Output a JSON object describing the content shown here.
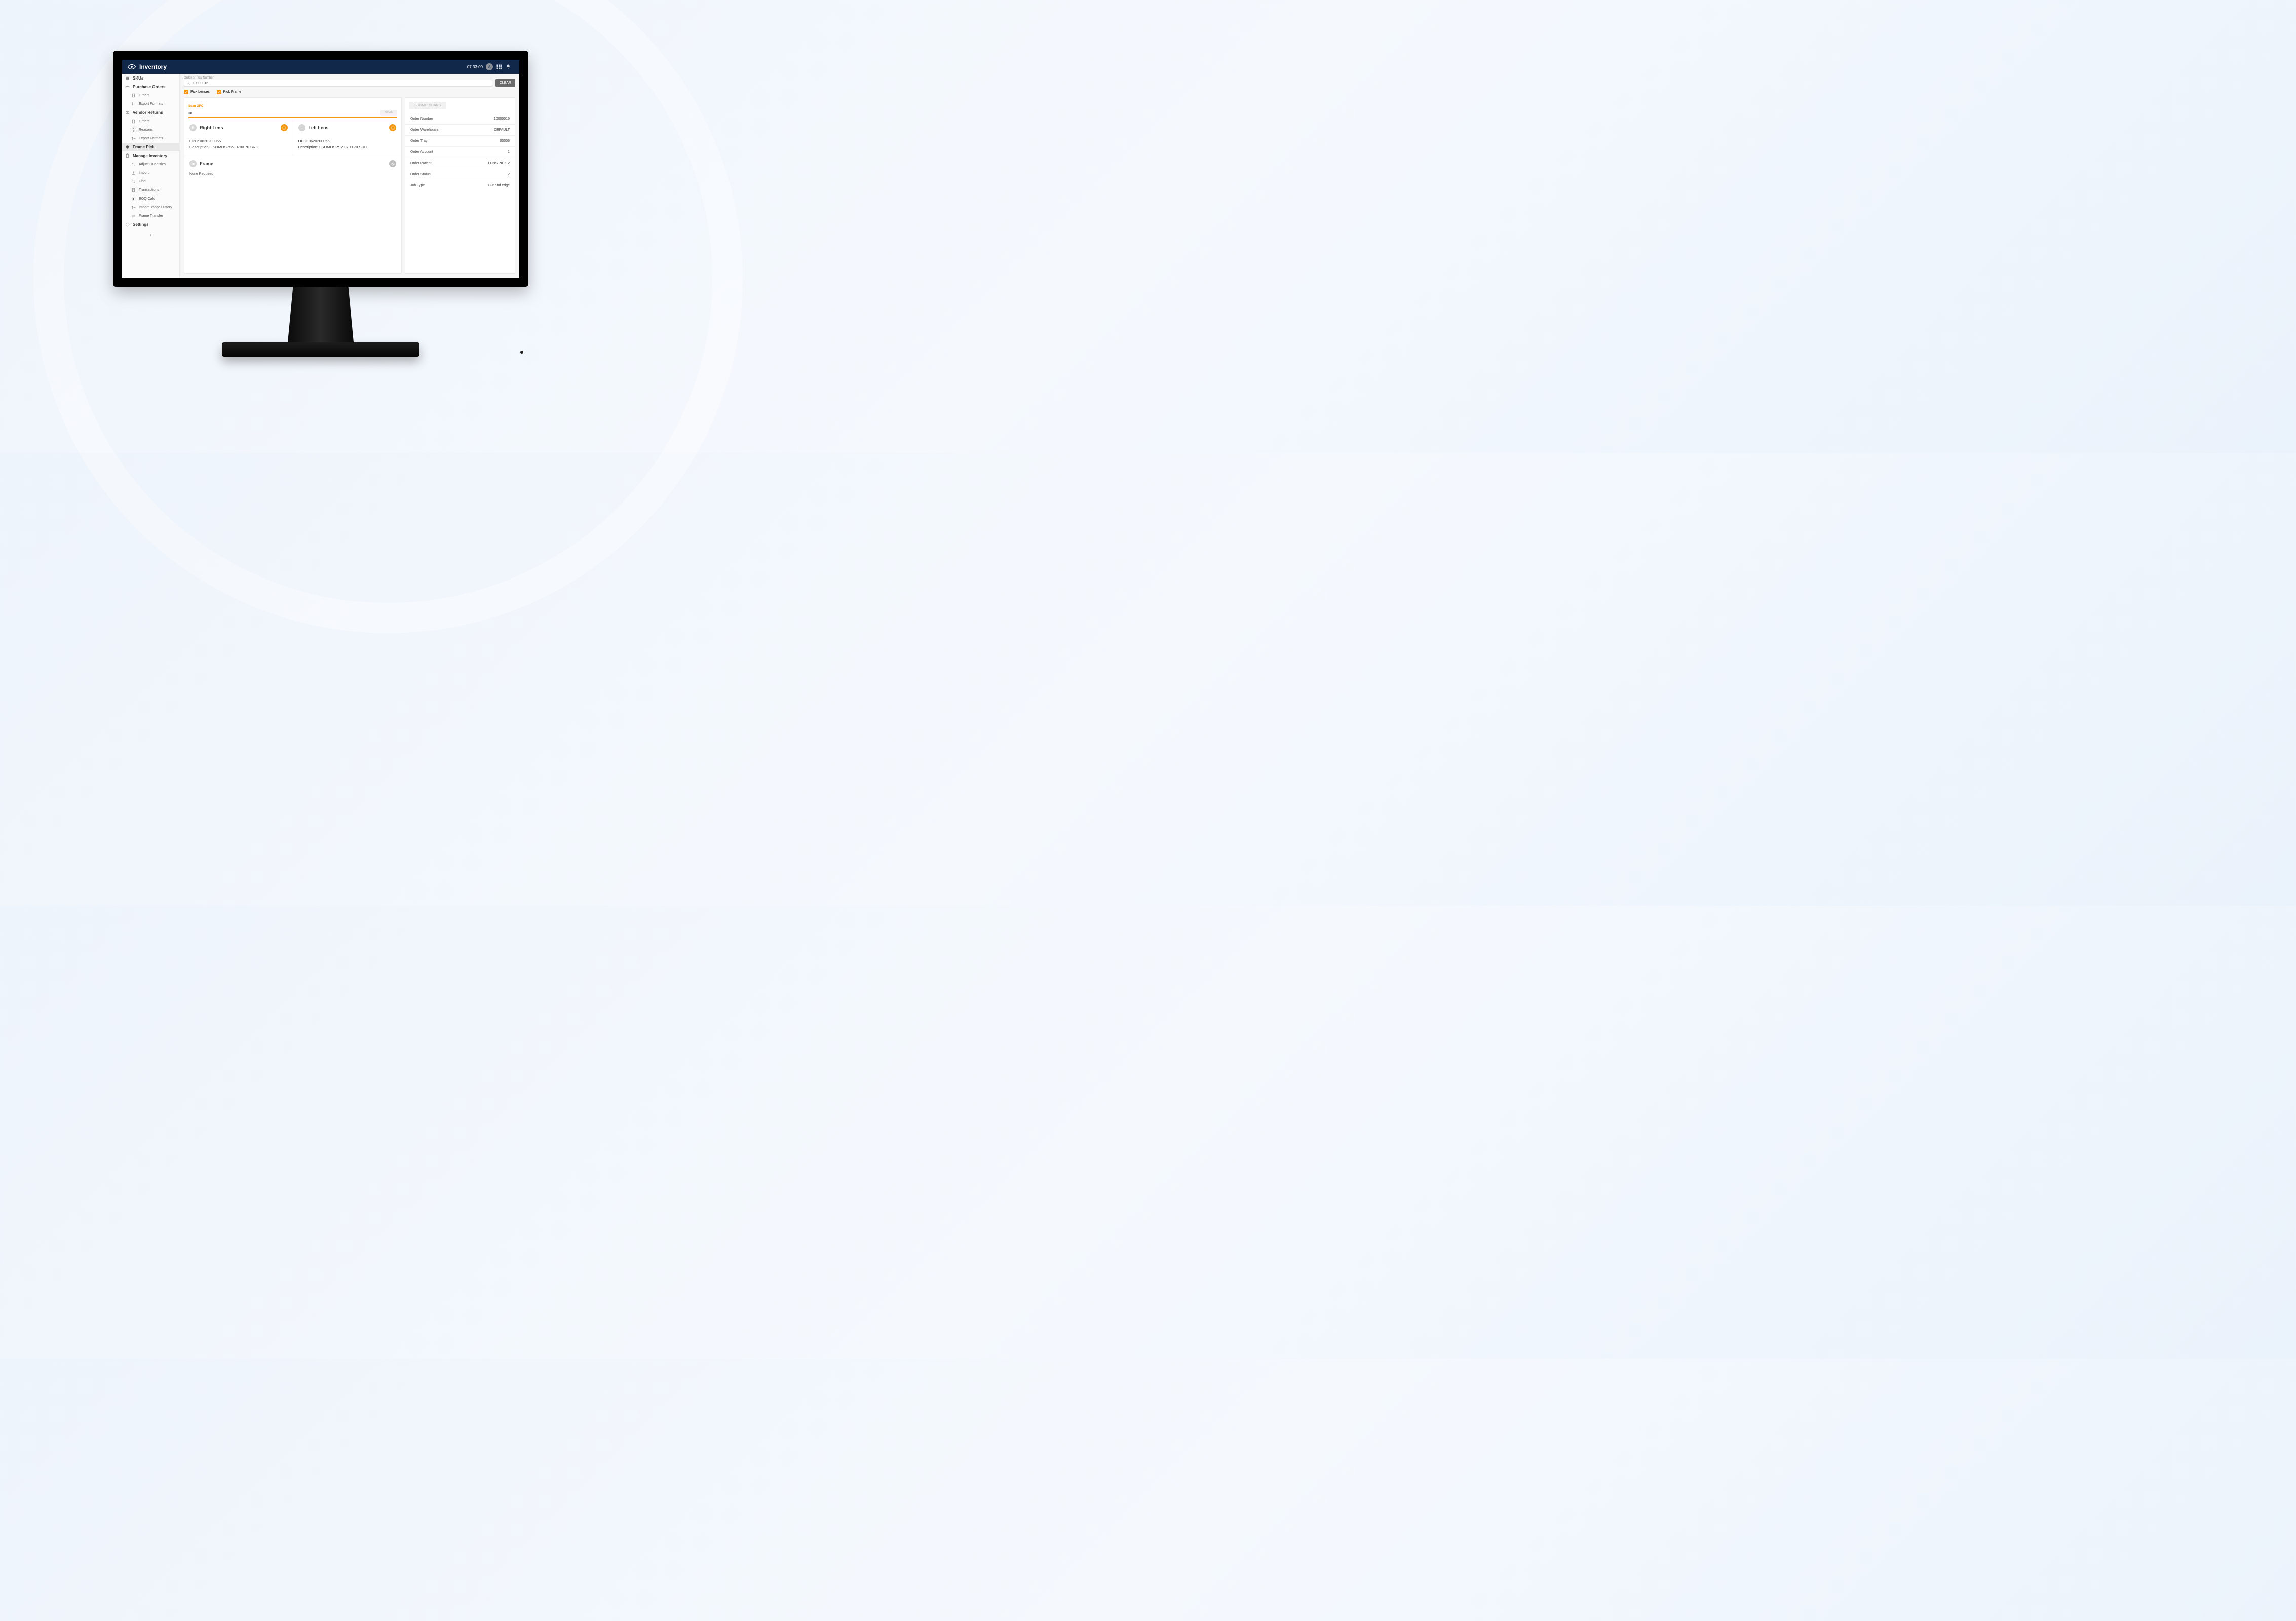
{
  "header": {
    "brand": "Inventory",
    "time": "07:33:00",
    "avatar_initial": "A"
  },
  "sidebar": {
    "skus": "SKUs",
    "purchase_orders": "Purchase Orders",
    "po_orders": "Orders",
    "po_export_formats": "Export Formats",
    "vendor_returns": "Vendor Returns",
    "vr_orders": "Orders",
    "vr_reasons": "Reasons",
    "vr_export_formats": "Export Formats",
    "frame_pick": "Frame Pick",
    "manage_inventory": "Manage Inventory",
    "adjust_quantities": "Adjust Quantities",
    "import": "Import",
    "find": "Find",
    "transactions": "Transactions",
    "eoq_calc": "EOQ Calc",
    "import_usage_history": "Import Usage History",
    "frame_transfer": "Frame Transfer",
    "settings": "Settings"
  },
  "search": {
    "label": "Order or Tray Number",
    "value": "10000016",
    "clear": "CLEAR"
  },
  "picks": {
    "lenses": "Pick Lenses",
    "frame": "Pick Frame"
  },
  "scan": {
    "label": "Scan OPC",
    "scan_btn": "SCAN",
    "submit_btn": "SUBMIT SCANS"
  },
  "lens_right": {
    "title": "Right Lens",
    "badge": "R",
    "opc": "OPC: 0620200055",
    "desc": "Description: LSOMOSPSV 0700 70 SRC"
  },
  "lens_left": {
    "title": "Left Lens",
    "badge": "L",
    "opc": "OPC: 0620200055",
    "desc": "Description: LSOMOSPSV 0700 70 SRC"
  },
  "frame": {
    "title": "Frame",
    "note": "None Required"
  },
  "order_info": {
    "rows": [
      {
        "label": "Order Number",
        "value": "10000016"
      },
      {
        "label": "Order Warehouse",
        "value": "DEFAULT"
      },
      {
        "label": "Order Tray",
        "value": "00006"
      },
      {
        "label": "Order Account",
        "value": "1"
      },
      {
        "label": "Order Patient",
        "value": "LENS PICK 2"
      },
      {
        "label": "Order Status",
        "value": "V"
      },
      {
        "label": "Job Type",
        "value": "Cut and edge"
      }
    ]
  }
}
